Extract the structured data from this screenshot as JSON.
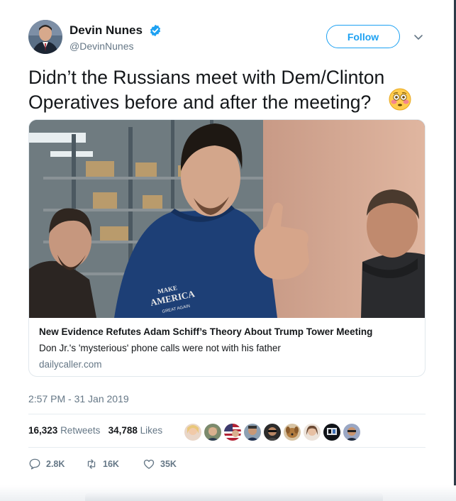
{
  "user": {
    "name": "Devin Nunes",
    "handle": "@DevinNunes",
    "verified": true,
    "follow_label": "Follow"
  },
  "tweet": {
    "text": "Didn’t the Russians meet with Dem/Clinton Operatives before and after the meeting?",
    "emoji": "flushed-face-emoji",
    "timestamp": "2:57 PM - 31 Jan 2019"
  },
  "card": {
    "title": "New Evidence Refutes Adam Schiff’s Theory About Trump Tower Meeting",
    "description": "Don Jr.'s 'mysterious' phone calls were not with his father",
    "domain": "dailycaller.com",
    "shirt_text_1": "MAKE",
    "shirt_text_2": "AMERICA",
    "shirt_text_3": "GREAT AGAIN"
  },
  "stats": {
    "retweets_count": "16,323",
    "retweets_label": "Retweets",
    "likes_count": "34,788",
    "likes_label": "Likes",
    "liker_avatar_count": 9
  },
  "actions": {
    "replies": "2.8K",
    "retweets": "16K",
    "likes": "35K"
  },
  "colors": {
    "accent": "#1da1f2",
    "secondary_text": "#657786",
    "primary_text": "#14171a",
    "border": "#e1e8ed"
  },
  "icons": {
    "verified": "verified-badge-icon",
    "caret": "chevron-down-icon",
    "reply": "reply-icon",
    "retweet": "retweet-icon",
    "like": "heart-icon"
  }
}
